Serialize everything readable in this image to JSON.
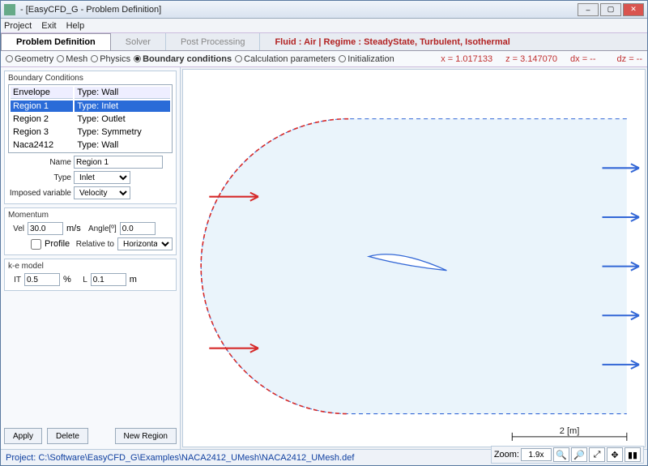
{
  "window": {
    "title": "- [EasyCFD_G - Problem Definition]"
  },
  "menu": {
    "project": "Project",
    "exit": "Exit",
    "help": "Help"
  },
  "tabs": {
    "problem_def": "Problem Definition",
    "solver": "Solver",
    "post": "Post Processing",
    "info": "Fluid : Air  |  Regime : SteadyState,  Turbulent, Isothermal"
  },
  "subtabs": {
    "geometry": "Geometry",
    "mesh": "Mesh",
    "physics": "Physics",
    "boundary": "Boundary conditions",
    "calc_params": "Calculation parameters",
    "initialization": "Initialization",
    "x": "x = 1.017133",
    "z": "z = 3.147070",
    "dx": "dx = --",
    "dz": "dz = --"
  },
  "bc": {
    "legend": "Boundary Conditions",
    "cols": {
      "name": "Envelope",
      "type": "Type: Wall"
    },
    "rows": [
      {
        "name": "Region 1",
        "type": "Type: Inlet",
        "selected": true
      },
      {
        "name": "Region 2",
        "type": "Type: Outlet"
      },
      {
        "name": "Region 3",
        "type": "Type: Symmetry"
      },
      {
        "name": "Naca2412",
        "type": "Type: Wall"
      }
    ],
    "name_label": "Name",
    "name_value": "Region 1",
    "type_label": "Type",
    "type_value": "Inlet",
    "imposed_label": "Imposed variable",
    "imposed_value": "Velocity"
  },
  "momentum": {
    "legend": "Momentum",
    "vel_label": "Vel",
    "vel_value": "30.0",
    "vel_unit": "m/s",
    "angle_label": "Angle[º]",
    "angle_value": "0.0",
    "profile_label": "Profile",
    "relative_label": "Relative to",
    "relative_value": "Horizontal"
  },
  "ke": {
    "legend": "k-e model",
    "it_label": "IT",
    "it_value": "0.5",
    "it_unit": "%",
    "L_label": "L",
    "L_value": "0.1",
    "L_unit": "m"
  },
  "buttons": {
    "apply": "Apply",
    "delete": "Delete",
    "new_region": "New Region"
  },
  "canvas": {
    "scale_label": "2 [m]"
  },
  "status": {
    "project_path": "Project: C:\\Software\\EasyCFD_G\\Examples\\NACA2412_UMesh\\NACA2412_UMesh.def"
  },
  "zoom": {
    "label": "Zoom:",
    "value": "1.9x"
  }
}
